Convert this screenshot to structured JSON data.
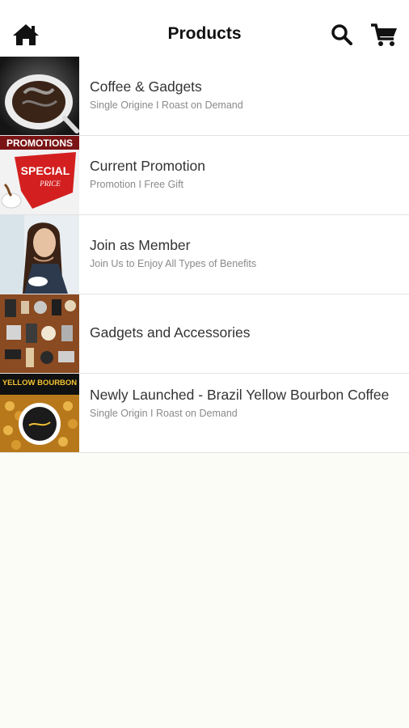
{
  "header": {
    "title": "Products",
    "home_icon": "home-icon",
    "search_icon": "search-icon",
    "cart_icon": "cart-icon"
  },
  "items": [
    {
      "title": "Coffee & Gadgets",
      "subtitle": "Single Origine I Roast on Demand",
      "thumb": "coffee-cup-image"
    },
    {
      "title": "Current Promotion",
      "subtitle": "Promotion I Free Gift",
      "thumb": "promotions-image",
      "thumb_text": [
        "PROMOTIONS",
        "SPECIAL",
        "PRICE"
      ]
    },
    {
      "title": "Join as Member",
      "subtitle": "Join Us to Enjoy All Types of Benefits",
      "thumb": "woman-with-coffee-image"
    },
    {
      "title": "Gadgets and Accessories",
      "subtitle": "",
      "thumb": "coffee-gadgets-image"
    },
    {
      "title": "Newly Launched - Brazil Yellow Bourbon Coffee",
      "subtitle": "Single Origin I Roast on Demand",
      "thumb": "yellow-bourbon-image",
      "thumb_text": [
        "YELLOW BOURBON"
      ]
    }
  ]
}
